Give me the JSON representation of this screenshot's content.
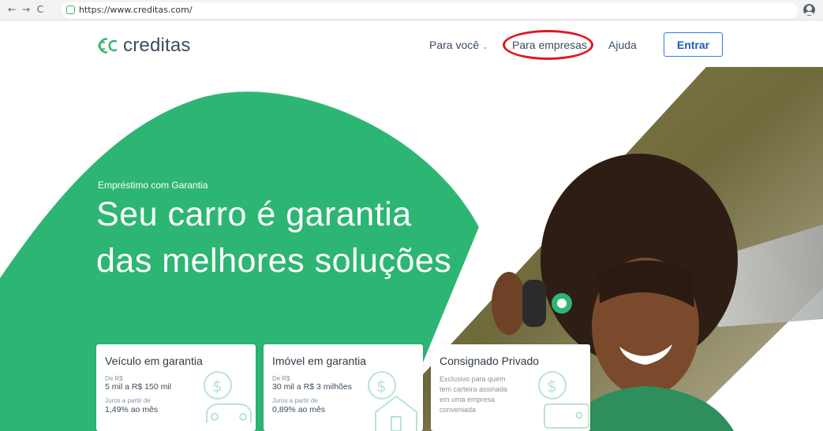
{
  "browser": {
    "url": "https://www.creditas.com/",
    "back_icon": "←",
    "forward_icon": "→",
    "reload_icon": "C"
  },
  "header": {
    "logo_text": "creditas",
    "nav": {
      "para_voce": "Para você",
      "para_empresas": "Para empresas",
      "ajuda": "Ajuda",
      "entrar": "Entrar"
    }
  },
  "hero": {
    "eyebrow": "Empréstimo com Garantia",
    "headline": "Seu carro é garantia das melhores soluções"
  },
  "cards": [
    {
      "title": "Veículo em garantia",
      "line1_small": "De R$",
      "line1_big": "5 mil a R$ 150 mil",
      "line2_small": "Juros a partir de",
      "line2_big": "1,49% ao mês"
    },
    {
      "title": "Imóvel em garantia",
      "line1_small": "De R$",
      "line1_big": "30 mil a R$ 3 milhões",
      "line2_small": "Juros a partir de",
      "line2_big": "0,89% ao mês"
    },
    {
      "title": "Consignado Privado",
      "description": "Exclusivo para quem tem carteira assinada em uma empresa conveniada"
    }
  ],
  "colors": {
    "brand_green": "#2db673",
    "highlight_circle": "#e3141e",
    "button_blue": "#2e7ee0"
  }
}
